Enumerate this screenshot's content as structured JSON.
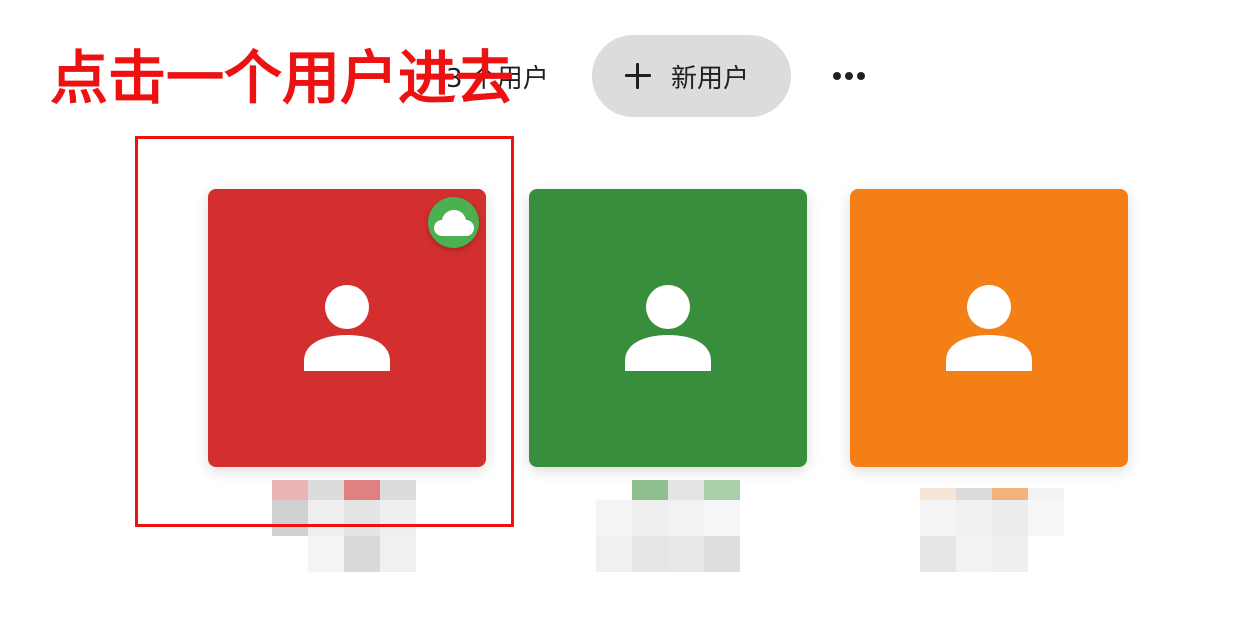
{
  "header": {
    "user_count": "3 个用户",
    "new_user_label": "新用户",
    "plus_icon": "plus-icon",
    "more_icon": "more-horizontal-icon"
  },
  "annotation": {
    "text": "点击一个用户进去",
    "color": "#ee1111"
  },
  "users": [
    {
      "color": "#d32f2f",
      "icon": "person-icon",
      "badge": "cloud-icon",
      "badge_color": "#4caf50"
    },
    {
      "color": "#388e3c",
      "icon": "person-icon"
    },
    {
      "color": "#f57f17",
      "icon": "person-icon"
    }
  ]
}
